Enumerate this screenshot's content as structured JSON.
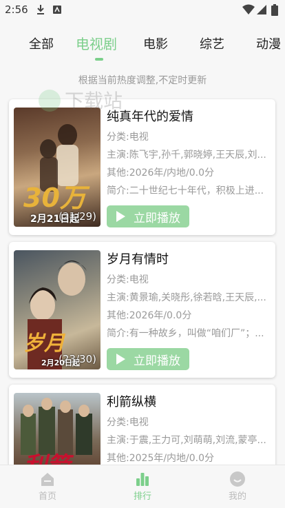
{
  "status_bar": {
    "time": "2:56"
  },
  "tabs": [
    {
      "label": "全部",
      "active": false
    },
    {
      "label": "电视剧",
      "active": true
    },
    {
      "label": "电影",
      "active": false
    },
    {
      "label": "综艺",
      "active": false
    },
    {
      "label": "动漫",
      "active": false
    }
  ],
  "subtitle": "根据当前热度调整,不定时更新",
  "watermark_text": "下载站",
  "items": [
    {
      "title": "纯真年代的爱情",
      "category": "分类:电视",
      "cast": "主演:陈飞宇,孙千,郭晓婷,王天辰,刘...",
      "other": "其他:2026年/内地/0.0分",
      "intro": "简介:二十世纪七十年代，积极上进...",
      "play_label": "立即播放",
      "poster_episode": "(21/29)",
      "poster_date": "2月21日起",
      "poster_text": "30万"
    },
    {
      "title": "岁月有情时",
      "category": "分类:电视",
      "cast": "主演:黄景瑜,关晓彤,徐若晗,王天辰,...",
      "other": "其他:2026年/0.0分",
      "intro": "简介:有一种故乡，叫做“咱们厂”；...",
      "play_label": "立即播放",
      "poster_episode": "(23/30)",
      "poster_date": "2月20日起",
      "poster_text": "岁月"
    },
    {
      "title": "利箭纵横",
      "category": "分类:电视",
      "cast": "主演:于震,王力可,刘萌萌,刘流,蒙亭...",
      "other": "其他:2025年/内地/0.0分",
      "intro": "",
      "play_label": "立即播放",
      "poster_episode": "",
      "poster_date": "",
      "poster_text": "利箭"
    }
  ],
  "bottom_nav": [
    {
      "label": "首页",
      "icon": "home-icon",
      "active": false
    },
    {
      "label": "排行",
      "icon": "ranking-icon",
      "active": true
    },
    {
      "label": "我的",
      "icon": "profile-icon",
      "active": false
    }
  ],
  "colors": {
    "accent": "#7ccf8b",
    "play_button": "#9bd8a3",
    "muted_text": "#999999"
  }
}
